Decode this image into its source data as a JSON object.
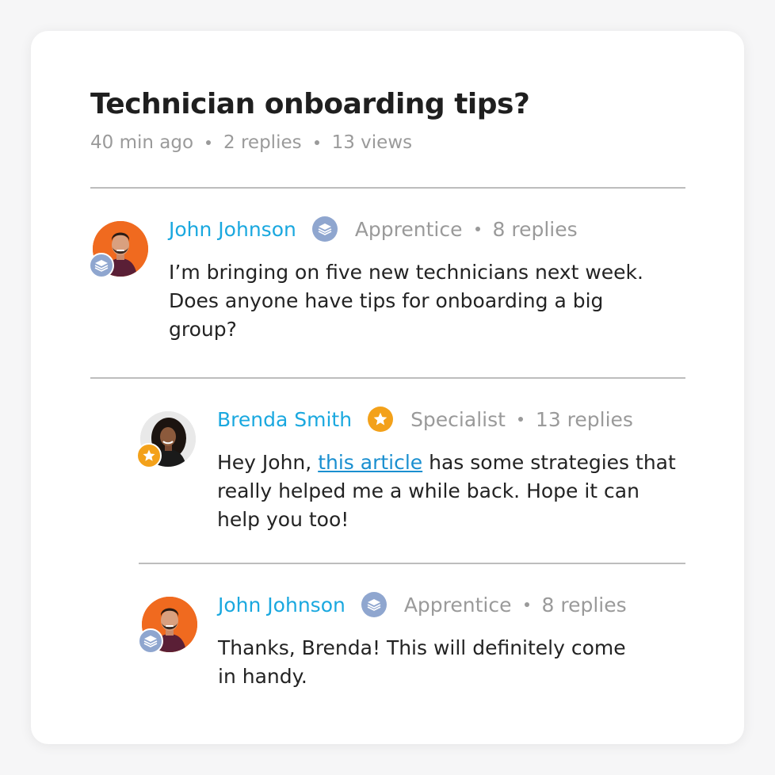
{
  "thread": {
    "title": "Technician onboarding tips?",
    "time_ago": "40 min ago",
    "replies": "2 replies",
    "views": "13 views"
  },
  "posts": [
    {
      "author": "John Johnson",
      "rank": "Apprentice",
      "rank_icon": "layers-icon",
      "replies": "8 replies",
      "body": "I’m bringing on five new technicians next week. Does anyone have tips for onboarding a big group?",
      "avatar_bg": "#f06a1f"
    },
    {
      "author": "Brenda Smith",
      "rank": "Specialist",
      "rank_icon": "star-icon",
      "replies": "13 replies",
      "body_before": "Hey John, ",
      "link_text": "this article",
      "body_after": " has some strategies that really helped me a while back. Hope it can help you too!",
      "avatar_bg": "#e9e9e9"
    },
    {
      "author": "John Johnson",
      "rank": "Apprentice",
      "rank_icon": "layers-icon",
      "replies": "8 replies",
      "body": "Thanks, Brenda! This will definitely come in handy.",
      "avatar_bg": "#f06a1f"
    }
  ],
  "colors": {
    "author_link": "#1aa8df",
    "inline_link": "#1a8fd0",
    "apprentice_badge": "#8fa6cf",
    "specialist_badge": "#f3a11a"
  }
}
